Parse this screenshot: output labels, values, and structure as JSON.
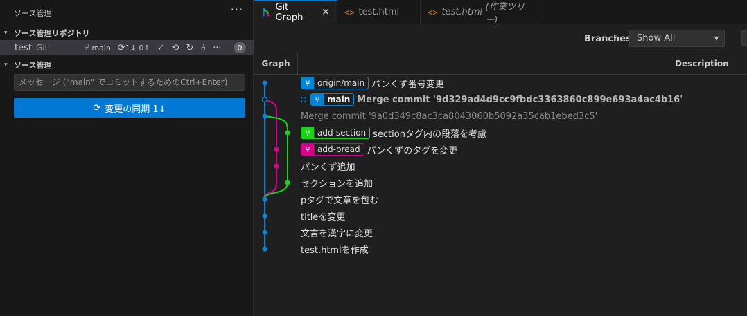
{
  "scm": {
    "title": "ソース管理",
    "more": "···",
    "repos_header": "ソース管理リポジトリ",
    "repo": {
      "name": "test",
      "type": "Git",
      "branch": "main",
      "sync": "1↓ 0↑",
      "badge": "0"
    },
    "changes_header": "ソース管理",
    "message_placeholder": "メッセージ (\"main\" でコミットするためのCtrl+Enter)",
    "sync_button": "変更の同期 1↓"
  },
  "tabs": [
    {
      "label": "Git Graph",
      "active": true
    },
    {
      "label": "test.html",
      "active": false
    },
    {
      "label": "test.html",
      "suffix": "(作業ツリー)",
      "active": false
    }
  ],
  "gitgraph": {
    "branches_label": "Branches:",
    "branches_value": "Show All",
    "col_graph": "Graph",
    "col_description": "Description",
    "colors": {
      "blue": "#0085d9",
      "green": "#16d616",
      "pink": "#d9008f"
    },
    "commits": [
      {
        "refs": [
          {
            "name": "origin/main",
            "color": "#0085d9"
          }
        ],
        "message": "パンくず番号変更",
        "lane": 0
      },
      {
        "refs": [
          {
            "name": "main",
            "color": "#0085d9",
            "current": true
          }
        ],
        "message": "Merge commit '9d329ad4d9cc9fbdc3363860c899e693a4ac4b16'",
        "lane": 0,
        "bold": true
      },
      {
        "refs": [],
        "message": "Merge commit '9a0d349c8ac3ca8043060b5092a35cab1ebed3c5'",
        "lane": 0,
        "dim": true
      },
      {
        "refs": [
          {
            "name": "add-section",
            "color": "#16d616"
          }
        ],
        "message": "sectionタグ内の段落を考慮",
        "lane": 2
      },
      {
        "refs": [
          {
            "name": "add-bread",
            "color": "#d9008f"
          }
        ],
        "message": "パンくずのタグを変更",
        "lane": 1
      },
      {
        "refs": [],
        "message": "パンくず追加",
        "lane": 1
      },
      {
        "refs": [],
        "message": "セクションを追加",
        "lane": 2
      },
      {
        "refs": [],
        "message": "pタグで文章を包む",
        "lane": 0
      },
      {
        "refs": [],
        "message": "titleを変更",
        "lane": 0
      },
      {
        "refs": [],
        "message": "文言を漢字に変更",
        "lane": 0
      },
      {
        "refs": [],
        "message": "test.htmlを作成",
        "lane": 0
      }
    ]
  }
}
